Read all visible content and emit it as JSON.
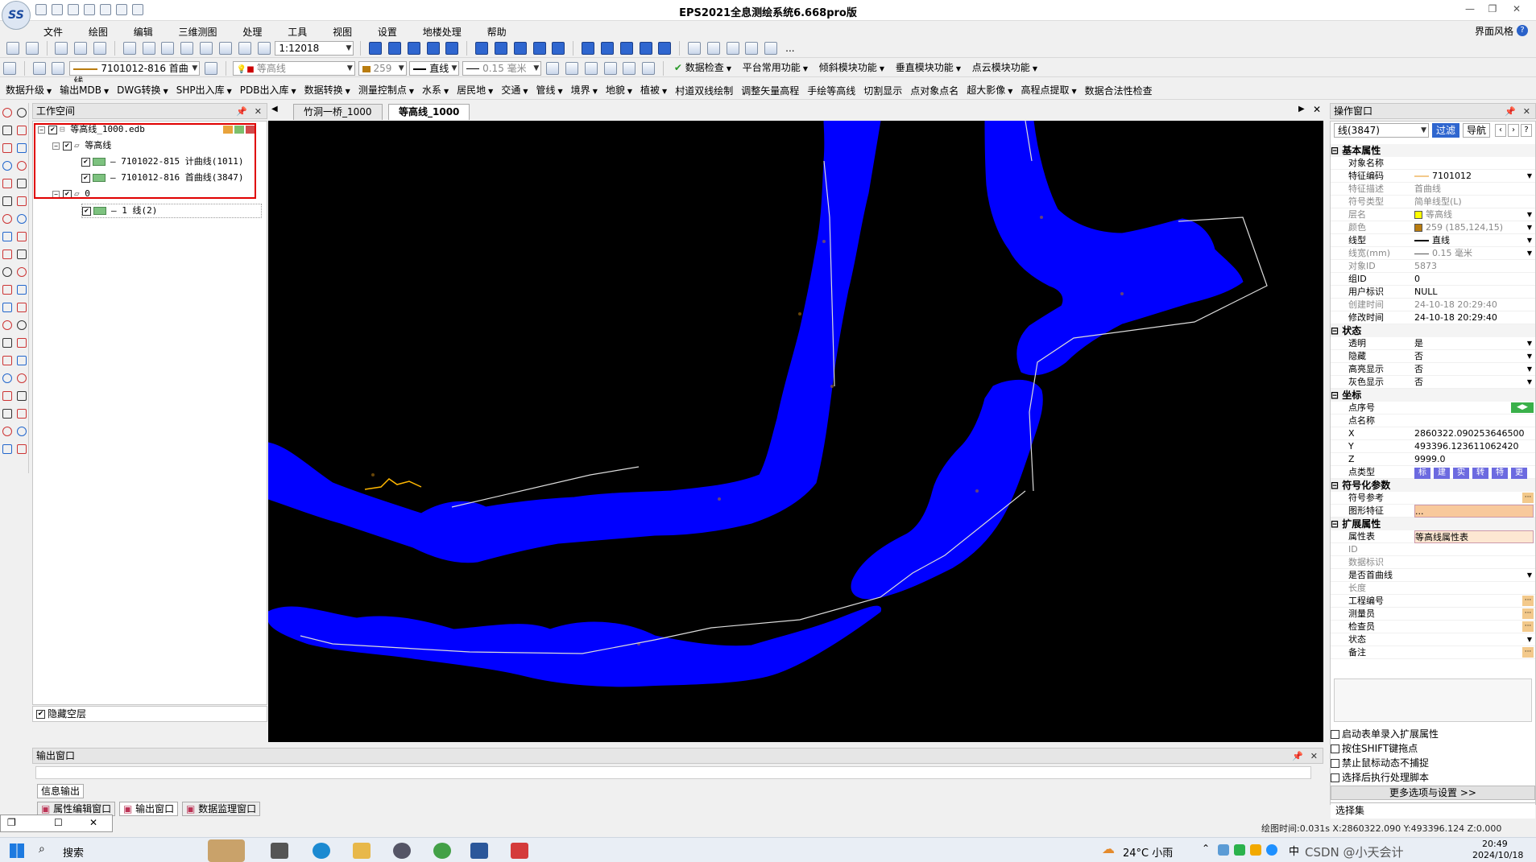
{
  "app": {
    "title": "EPS2021全息测绘系统6.668pro版",
    "logo_text": "SS",
    "skin_label": "界面风格",
    "help_icon": "?"
  },
  "menu": [
    "文件",
    "绘图",
    "编辑",
    "三维测图",
    "处理",
    "工具",
    "视图",
    "设置",
    "地楼处理",
    "帮助"
  ],
  "toolbar1": {
    "scale": "1:12018",
    "text_extra": "..."
  },
  "toolbar2": {
    "code_combo": "7101012-816 首曲线",
    "layer_combo": "等高线",
    "color_combo": "259",
    "linetype_combo": "直线",
    "linewidth_combo": "0.15 毫米",
    "menus": [
      "数据检查",
      "平台常用功能",
      "倾斜模块功能",
      "垂直模块功能",
      "点云模块功能"
    ]
  },
  "toolbar3": {
    "items": [
      "数据升级",
      "输出MDB",
      "DWG转换",
      "SHP出入库",
      "PDB出入库",
      "数据转换",
      "测量控制点",
      "水系",
      "居民地",
      "交通",
      "管线",
      "境界",
      "地貌",
      "植被",
      "村道双线绘制",
      "调整矢量高程",
      "手绘等高线",
      "切割显示",
      "点对象点名",
      "超大影像",
      "高程点提取",
      "数据合法性检查"
    ],
    "dropdown_flags": [
      true,
      true,
      true,
      true,
      true,
      true,
      true,
      true,
      true,
      true,
      true,
      true,
      true,
      true,
      false,
      false,
      false,
      false,
      false,
      true,
      true,
      false
    ]
  },
  "workspace": {
    "title": "工作空间",
    "pin": "📌",
    "close": "✕",
    "tree": [
      {
        "label": "等高线_1000.edb",
        "level": 0
      },
      {
        "label": "等高线",
        "level": 1
      },
      {
        "label": "7101022-815 计曲线(1011)",
        "level": 2
      },
      {
        "label": "7101012-816 首曲线(3847)",
        "level": 2
      },
      {
        "label": "0",
        "level": 1
      },
      {
        "label": "1 线(2)",
        "level": 2
      }
    ],
    "hide_empty_layers": "隐藏空层"
  },
  "doc_tabs": [
    "竹洞一桥_1000",
    "等高线_1000"
  ],
  "output": {
    "title": "输出窗口",
    "info_tab": "信息输出",
    "bottom_tabs": [
      "属性编辑窗口",
      "输出窗口",
      "数据监理窗口"
    ]
  },
  "operation": {
    "title": "操作窗口",
    "object_combo": "线(3847)",
    "filter_btn": "过滤",
    "nav_btn": "导航",
    "prev_btn": "‹",
    "next_btn": "›",
    "help_btn": "?",
    "groups": {
      "basic": "基本属性",
      "state": "状态",
      "coord": "坐标",
      "symbol": "符号化参数",
      "ext": "扩展属性"
    },
    "basic_props": [
      {
        "k": "对象名称",
        "v": "",
        "gray": false
      },
      {
        "k": "特征编码",
        "v": "7101012",
        "gray": false
      },
      {
        "k": "特征描述",
        "v": "首曲线",
        "gray": true
      },
      {
        "k": "符号类型",
        "v": "简单线型(L)",
        "gray": true
      },
      {
        "k": "层名",
        "v": "等高线",
        "gray": true
      },
      {
        "k": "颜色",
        "v": "259 (185,124,15)",
        "gray": true
      },
      {
        "k": "线型",
        "v": "直线",
        "gray": false
      },
      {
        "k": "线宽(mm)",
        "v": "0.15 毫米",
        "gray": true
      },
      {
        "k": "对象ID",
        "v": "5873",
        "gray": true
      },
      {
        "k": "组ID",
        "v": "0",
        "gray": false
      },
      {
        "k": "用户标识",
        "v": "NULL",
        "gray": false
      },
      {
        "k": "创建时间",
        "v": "24-10-18 20:29:40",
        "gray": true
      },
      {
        "k": "修改时间",
        "v": "24-10-18 20:29:40",
        "gray": false
      }
    ],
    "state_props": [
      {
        "k": "透明",
        "v": "是"
      },
      {
        "k": "隐藏",
        "v": "否"
      },
      {
        "k": "高亮显示",
        "v": "否"
      },
      {
        "k": "灰色显示",
        "v": "否"
      }
    ],
    "coord_props": [
      {
        "k": "点序号",
        "v": ""
      },
      {
        "k": "点名称",
        "v": ""
      },
      {
        "k": "X",
        "v": "2860322.090253646500"
      },
      {
        "k": "Y",
        "v": "493396.123611062420"
      },
      {
        "k": "Z",
        "v": "9999.0"
      },
      {
        "k": "点类型",
        "v": ""
      }
    ],
    "point_type_btns": [
      "标",
      "建",
      "实",
      "转",
      "特",
      "更"
    ],
    "symbol_props": [
      {
        "k": "符号参考",
        "v": ""
      },
      {
        "k": "图形特征",
        "v": "..."
      }
    ],
    "ext_props": [
      {
        "k": "属性表",
        "v": "等高线属性表",
        "gray": false
      },
      {
        "k": "ID",
        "v": "",
        "gray": true
      },
      {
        "k": "数据标识",
        "v": "",
        "gray": true
      },
      {
        "k": "是否首曲线",
        "v": "",
        "gray": false
      },
      {
        "k": "长度",
        "v": "",
        "gray": true
      },
      {
        "k": "工程编号",
        "v": "",
        "gray": false
      },
      {
        "k": "测量员",
        "v": "",
        "gray": false
      },
      {
        "k": "检查员",
        "v": "",
        "gray": false
      },
      {
        "k": "状态",
        "v": "",
        "gray": false
      },
      {
        "k": "备注",
        "v": "",
        "gray": false
      }
    ],
    "options": [
      "启动表单录入扩展属性",
      "按住SHIFT键拖点",
      "禁止鼠标动态不捕捉",
      "选择后执行处理脚本"
    ],
    "more_btn": "更多选项与设置 >>",
    "selection_tab": "选择集"
  },
  "status": {
    "text": "绘图时间:0.031s X:2860322.090 Y:493396.124 Z:0.000"
  },
  "taskbar": {
    "search": "搜索",
    "weather": "24°C 小雨",
    "ime": "中",
    "time": "20:49",
    "date": "2024/10/18",
    "watermark": "CSDN @小天会计"
  },
  "colors": {
    "selection_red": "#e00000",
    "contour_blue": "#0000ff",
    "map_bg": "#000000",
    "accent": "#2f66cf"
  }
}
